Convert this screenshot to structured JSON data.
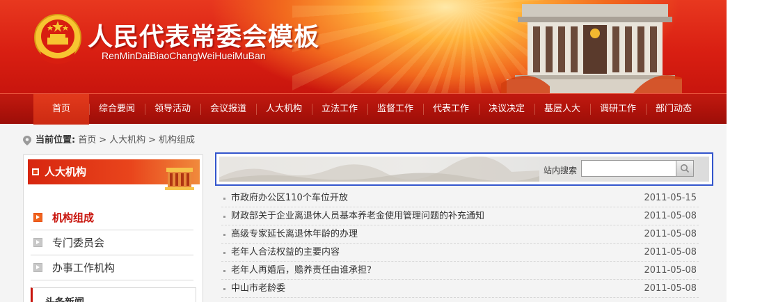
{
  "header": {
    "title": "人民代表常委会模板",
    "pinyin": "RenMinDaiBiaoChangWeiHueiMuBan"
  },
  "nav": {
    "items": [
      {
        "label": "首页"
      },
      {
        "label": "综合要闻"
      },
      {
        "label": "领导活动"
      },
      {
        "label": "会议报道"
      },
      {
        "label": "人大机构"
      },
      {
        "label": "立法工作"
      },
      {
        "label": "监督工作"
      },
      {
        "label": "代表工作"
      },
      {
        "label": "决议决定"
      },
      {
        "label": "基层人大"
      },
      {
        "label": "调研工作"
      },
      {
        "label": "部门动态"
      }
    ],
    "active_index": 0
  },
  "breadcrumb": {
    "prefix": "当前位置:",
    "items": [
      "首页",
      "人大机构",
      "机构组成"
    ],
    "separator": ">"
  },
  "sidebar": {
    "title": "人大机构",
    "items": [
      {
        "label": "机构组成"
      },
      {
        "label": "专门委员会"
      },
      {
        "label": "办事工作机构"
      }
    ],
    "active_index": 0,
    "news_title": "头条新闻"
  },
  "search": {
    "label": "站内搜索",
    "value": ""
  },
  "news": [
    {
      "title": "市政府办公区110个车位开放",
      "date": "2011-05-15"
    },
    {
      "title": "财政部关于企业离退休人员基本养老金使用管理问题的补充通知",
      "date": "2011-05-08"
    },
    {
      "title": "高级专家延长离退休年龄的办理",
      "date": "2011-05-08"
    },
    {
      "title": "老年人合法权益的主要内容",
      "date": "2011-05-08"
    },
    {
      "title": "老年人再婚后，赡养责任由谁承担？",
      "date": "2011-05-08"
    },
    {
      "title": "中山市老龄委",
      "date": "2011-05-08"
    }
  ],
  "colors": {
    "brand_red": "#c8140c",
    "nav_red": "#b0130b",
    "search_frame": "#3355cc"
  }
}
